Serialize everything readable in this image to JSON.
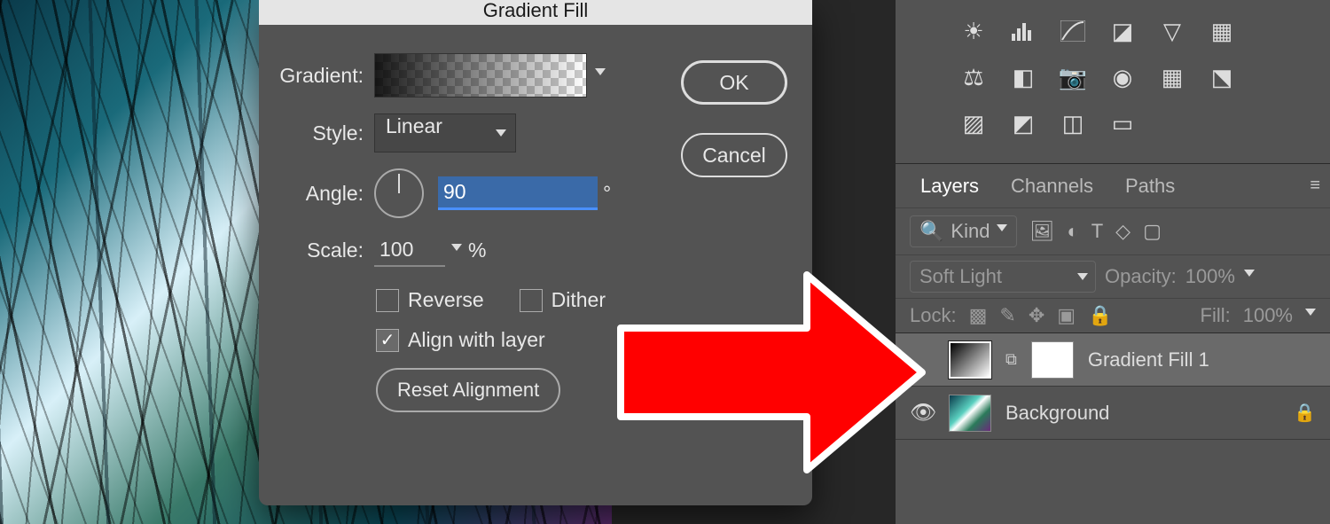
{
  "dialog": {
    "title": "Gradient Fill",
    "gradient_label": "Gradient:",
    "style_label": "Style:",
    "style_value": "Linear",
    "angle_label": "Angle:",
    "angle_value": "90",
    "angle_unit": "°",
    "scale_label": "Scale:",
    "scale_value": "100",
    "scale_unit": "%",
    "reverse_label": "Reverse",
    "reverse_checked": false,
    "dither_label": "Dither",
    "dither_checked": false,
    "align_label": "Align with layer",
    "align_checked": true,
    "reset_label": "Reset Alignment",
    "ok_label": "OK",
    "cancel_label": "Cancel"
  },
  "panels": {
    "tabs": {
      "layers": "Layers",
      "channels": "Channels",
      "paths": "Paths"
    },
    "kind_label": "Kind",
    "blend_mode": "Soft Light",
    "opacity_label": "Opacity:",
    "opacity_value": "100%",
    "lock_label": "Lock:",
    "fill_label": "Fill:",
    "fill_value": "100%",
    "layers": [
      {
        "name": "Gradient Fill 1",
        "selected": true,
        "locked": false,
        "visible": false
      },
      {
        "name": "Background",
        "selected": false,
        "locked": true,
        "visible": true
      }
    ]
  }
}
